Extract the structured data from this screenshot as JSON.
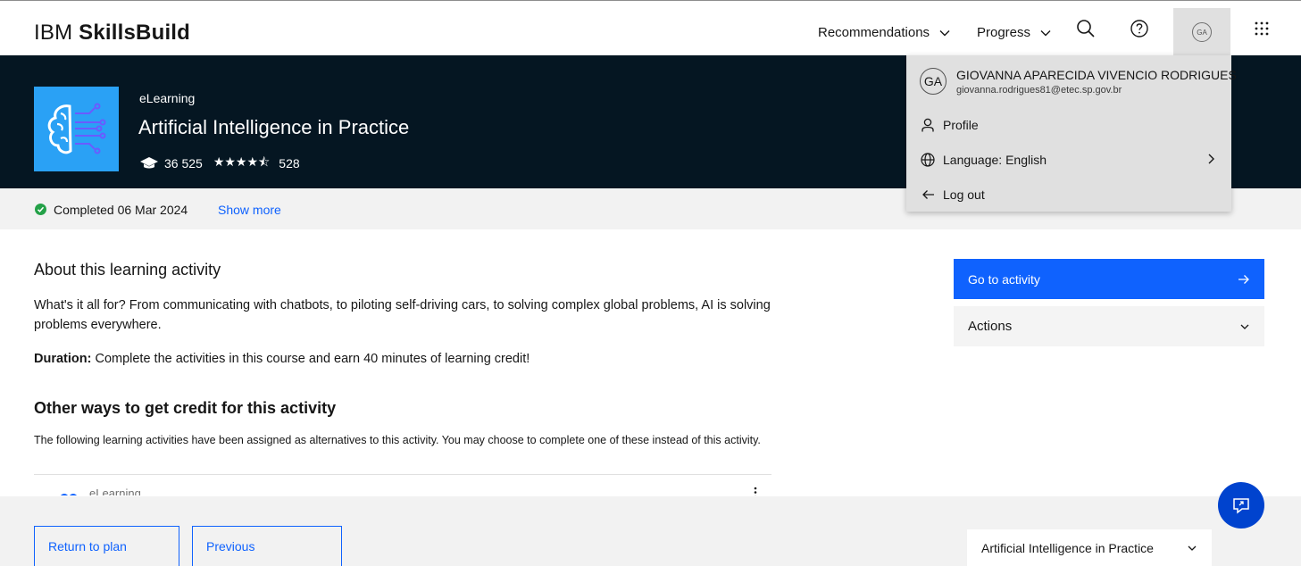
{
  "header": {
    "brand_light": "IBM ",
    "brand_bold": "SkillsBuild",
    "nav": [
      {
        "label": "Recommendations"
      },
      {
        "label": "Progress"
      }
    ],
    "avatar_initials": "GA",
    "icons": [
      "search-icon",
      "help-icon",
      "app-switcher-icon"
    ]
  },
  "hero": {
    "type": "eLearning",
    "title": "Artificial Intelligence in Practice",
    "learners": "36 525",
    "stars": "★★★★",
    "reviews": "528",
    "rating_out_of_5": 4.5
  },
  "status": {
    "completed": "Completed 06 Mar 2024",
    "show_more": "Show more"
  },
  "about": {
    "heading": "About this learning activity",
    "description": "What's it all for? From communicating with chatbots, to piloting self-driving cars, to solving complex global problems, AI is solving problems everywhere.",
    "duration_label": "Duration:",
    "duration_text": " Complete the activities in this course and earn 40 minutes of learning credit!"
  },
  "other": {
    "heading": "Other ways to get credit for this activity",
    "description": "The following learning activities have been assigned as alternatives to this activity. You may choose to complete one of these instead of this activity.",
    "item_label": "eLearning"
  },
  "sidebar": {
    "go_to_activity": "Go to activity",
    "actions": "Actions"
  },
  "footer": {
    "return_to_plan": "Return to plan",
    "previous": "Previous",
    "course_select": "Artificial Intelligence in Practice"
  },
  "user_menu": {
    "initials": "GA",
    "name": "GIOVANNA APARECIDA VIVENCIO RODRIGUES",
    "email": "giovanna.rodrigues81@etec.sp.gov.br",
    "items": [
      {
        "label": "Profile",
        "icon": "user-icon"
      },
      {
        "label": "Language: English",
        "icon": "globe-icon"
      },
      {
        "label": "Log out",
        "icon": "arrow-left-icon"
      }
    ]
  },
  "colors": {
    "hero_bg": "#051622",
    "primary": "#0f62fe",
    "thumb": "#2aa1f5",
    "success": "#24a148",
    "menu_bg": "#e0e0e0"
  }
}
